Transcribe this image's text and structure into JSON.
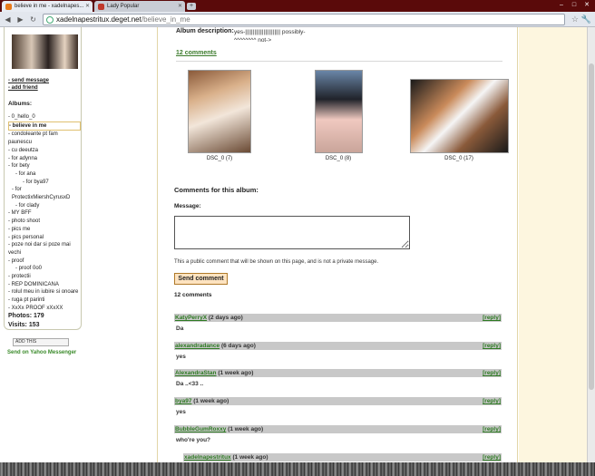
{
  "browser": {
    "tabs": [
      {
        "label": "believe in me - xadelnapes...",
        "favicon_color": "#e87a1a"
      },
      {
        "label": "Lady Popular",
        "favicon_color": "#c0392b"
      }
    ],
    "new_tab": "+",
    "url_domain": "xadelnapestritux.deget.net",
    "url_path": "/believe_in_me",
    "nav": {
      "back": "◀",
      "forward": "▶",
      "reload": "↻"
    },
    "star_icon": "☆",
    "wrench_icon": "🔧"
  },
  "sidebar": {
    "links": [
      "- send message",
      "- add friend"
    ],
    "albums_heading": "Albums:",
    "albums": [
      "- 0_hello_0",
      "- believe in me",
      "- condoleante pt fam paunescu",
      "- cu deeutza",
      "- for adynna",
      "- for bety",
      "- for ana",
      "- for bya97",
      "- for ProtectixMiershCyrusxD",
      "- for clady",
      "- MY BFF",
      "- photo shoot",
      "- pics me",
      "- pics personal",
      "- poze noi dar si poze mai vechi",
      "- proof",
      "- proof 0o0",
      "- protectii",
      "- REP DOMINICANA",
      "- rolul meu in iubire si onoare",
      "- ruga pt parinti",
      "- XxXx PROOF xXxXX"
    ],
    "photos_label": "Photos: 179",
    "visits_label": "Visits: 153",
    "addthis": "ADD THIS",
    "yahoo_link": "Send on Yahoo Messenger"
  },
  "album": {
    "description_label": "Album description:",
    "description_text": "yes-||||||||||||||||||||||| possibly-^^^^^^^^ not->",
    "comments_link": "12 comments",
    "photos": [
      {
        "caption": "DSC_0 (7)"
      },
      {
        "caption": "DSC_0 (8)"
      },
      {
        "caption": "DSC_0 (17)"
      }
    ]
  },
  "comment_form": {
    "heading": "Comments for this album:",
    "message_label": "Message:",
    "message_value": "",
    "public_note": "This a public comment that will be shown on this page, and is not a private message.",
    "send_label": "Send comment",
    "count_label": "12 comments"
  },
  "comments": [
    {
      "author": "KatyPerryX",
      "time": "(2 days ago)",
      "text": "Da",
      "reply": "[reply]"
    },
    {
      "author": "alexandradance",
      "time": "(6 days ago)",
      "text": "yes",
      "reply": "[reply]"
    },
    {
      "author": "AlexandraStan",
      "time": "(1 week ago)",
      "text": "Da ..<33 ..",
      "reply": "[reply]"
    },
    {
      "author": "bya97",
      "time": "(1 week ago)",
      "text": "yes",
      "reply": "[reply]"
    },
    {
      "author": "BubbleGumRoxxy",
      "time": "(1 week ago)",
      "text": "who're you?",
      "reply": "[reply]"
    },
    {
      "author": "xadelnapestritux",
      "time": "(1 week ago)",
      "text": "",
      "reply": "[reply]"
    }
  ]
}
